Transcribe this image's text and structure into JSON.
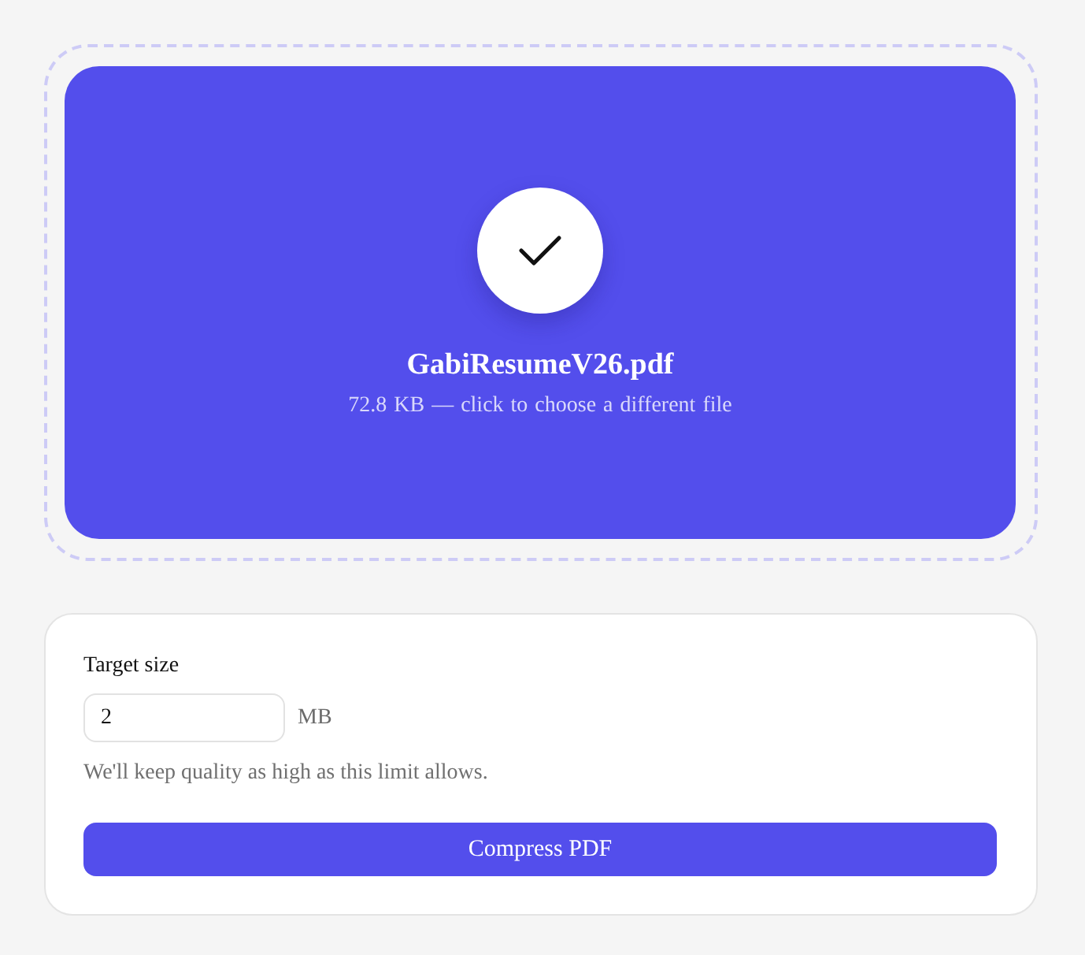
{
  "upload": {
    "file_name": "GabiResumeV26.pdf",
    "file_info": "72.8 KB — click to choose a different file"
  },
  "target_size": {
    "label": "Target size",
    "value": "2",
    "unit": "MB",
    "hint": "We'll keep quality as high as this limit allows."
  },
  "action_button": {
    "label": "Compress PDF"
  }
}
